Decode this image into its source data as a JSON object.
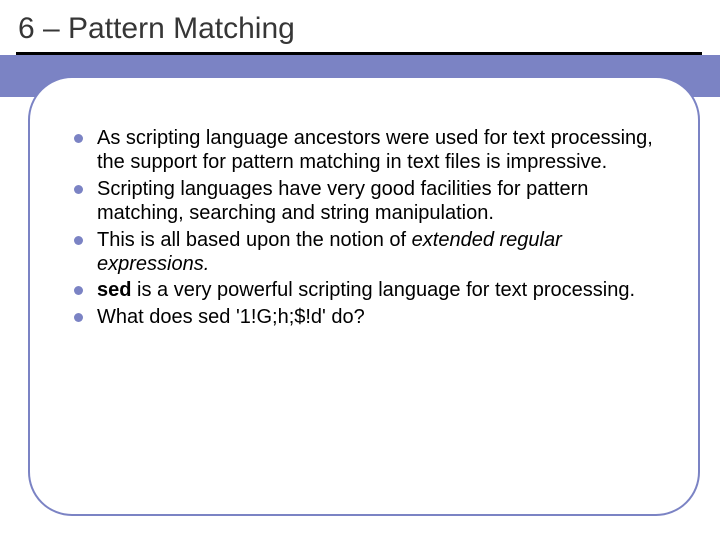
{
  "title": "6 – Pattern Matching",
  "bullets": {
    "b0a": "As scripting language ancestors were used for text processing, the support for pattern matching in text files is impressive.",
    "b1a": "Scripting languages have very good facilities for pattern matching, searching and string manipulation.",
    "b2a": "This is all based upon the notion of ",
    "b2b": "extended regular expressions.",
    "b3a": "sed",
    "b3b": " is a very powerful scripting language for text processing.",
    "b4a": "What does sed '1!G;h;$!d' do?"
  }
}
